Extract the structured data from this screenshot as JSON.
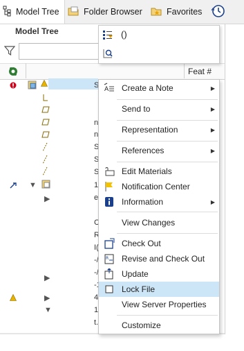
{
  "tabs": [
    {
      "label": "Model Tree",
      "icon": "model-tree-icon"
    },
    {
      "label": "Folder Browser",
      "icon": "folder-browser-icon"
    },
    {
      "label": "Favorites",
      "icon": "favorites-icon"
    },
    {
      "label": "",
      "icon": "history-icon"
    }
  ],
  "panel": {
    "title": "Model Tree",
    "filter_placeholder": "",
    "column_header": "Feat #"
  },
  "popup": {
    "item1_label": "()",
    "icons": [
      "tree-filter-icon",
      "search-tree-icon"
    ]
  },
  "tree_fragments": [
    "S",
    "n",
    "n",
    "S",
    "S",
    "S",
    "1!",
    "e",
    "C",
    "R",
    "I(",
    "-/",
    "-/",
    "-1",
    "4",
    "1·",
    "t."
  ],
  "context_menu": {
    "items": [
      {
        "label": "Create a Note",
        "icon": "note-icon",
        "submenu": true
      },
      {
        "label": "Send to",
        "icon": "",
        "submenu": true
      },
      {
        "label": "Representation",
        "icon": "",
        "submenu": true
      },
      {
        "label": "References",
        "icon": "",
        "submenu": true
      },
      {
        "label": "Edit Materials",
        "icon": "materials-icon",
        "submenu": false
      },
      {
        "label": "Notification Center",
        "icon": "flag-icon",
        "submenu": false
      },
      {
        "label": "Information",
        "icon": "info-icon",
        "submenu": true
      },
      {
        "label": "View Changes",
        "icon": "",
        "submenu": false
      },
      {
        "label": "Check Out",
        "icon": "check-out-icon",
        "submenu": false
      },
      {
        "label": "Revise and Check Out",
        "icon": "revise-icon",
        "submenu": false
      },
      {
        "label": "Update",
        "icon": "update-icon",
        "submenu": false
      },
      {
        "label": "Lock File",
        "icon": "lock-checkbox-icon",
        "submenu": false,
        "highlighted": true
      },
      {
        "label": "View Server Properties",
        "icon": "",
        "submenu": false
      },
      {
        "label": "Customize",
        "icon": "",
        "submenu": false
      }
    ]
  },
  "colors": {
    "accent_highlight": "#cde6f7",
    "warning": "#e8b400",
    "error": "#d0021b",
    "info": "#1a3f8c"
  }
}
